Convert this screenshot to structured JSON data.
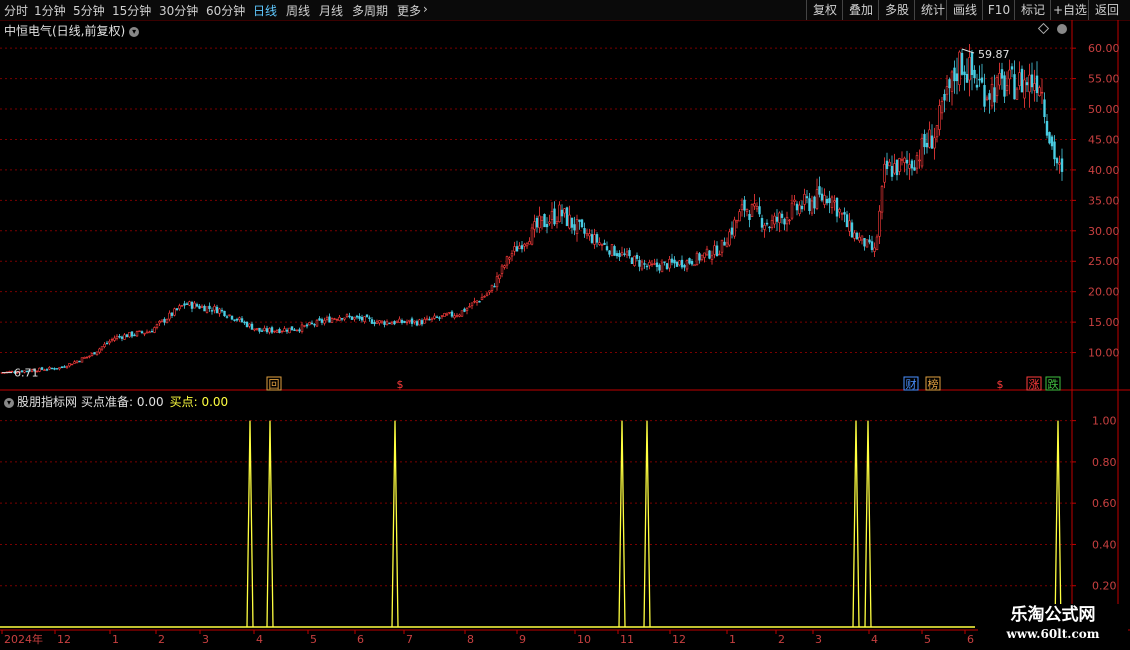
{
  "toolbar": {
    "periods": [
      {
        "label": "分时",
        "x": 4,
        "active": false
      },
      {
        "label": "1分钟",
        "x": 34,
        "active": false
      },
      {
        "label": "5分钟",
        "x": 73,
        "active": false
      },
      {
        "label": "15分钟",
        "x": 112,
        "active": false
      },
      {
        "label": "30分钟",
        "x": 159,
        "active": false
      },
      {
        "label": "60分钟",
        "x": 206,
        "active": false
      },
      {
        "label": "日线",
        "x": 253,
        "active": true
      },
      {
        "label": "周线",
        "x": 286,
        "active": false
      },
      {
        "label": "月线",
        "x": 319,
        "active": false
      },
      {
        "label": "多周期",
        "x": 352,
        "active": false
      },
      {
        "label": "更多",
        "x": 397,
        "active": false
      }
    ],
    "actions": [
      {
        "label": "复权",
        "x": 806,
        "w": 36
      },
      {
        "label": "叠加",
        "x": 842,
        "w": 36
      },
      {
        "label": "多股",
        "x": 878,
        "w": 36
      },
      {
        "label": "统计",
        "x": 914,
        "w": 36
      },
      {
        "label": "画线",
        "x": 946,
        "w": 36
      },
      {
        "label": "F10",
        "x": 982,
        "w": 32
      },
      {
        "label": "标记",
        "x": 1014,
        "w": 36
      },
      {
        "label": "+自选",
        "x": 1050,
        "w": 38
      },
      {
        "label": "返回",
        "x": 1088,
        "w": 36
      }
    ]
  },
  "stock_title": "中恒电气(日线,前复权)",
  "indicator": {
    "name": "股朋指标网",
    "label_a": "买点准备: 0.00",
    "label_b": "买点: 0.00"
  },
  "colors": {
    "up": "#ff3c3c",
    "down": "#4ad0e6",
    "grid": "#7a0000",
    "axis": "#c00000",
    "signal": "#ffff40",
    "active": "#5fc8ff"
  },
  "chart_data": [
    {
      "type": "candlestick",
      "title": "中恒电气(日线,前复权)",
      "ylim": [
        5,
        62
      ],
      "y_ticks": [
        10,
        15,
        20,
        25,
        30,
        35,
        40,
        45,
        50,
        55,
        60
      ],
      "y_tick_labels": [
        "10.00",
        "15.00",
        "20.00",
        "25.00",
        "30.00",
        "35.00",
        "40.00",
        "45.00",
        "50.00",
        "55.00",
        "60.00"
      ],
      "annotations": {
        "high": "59.87",
        "low": "6.71"
      },
      "event_marks": [
        "回",
        "$",
        "财",
        "榜",
        "$",
        "涨",
        "跌"
      ],
      "x_labels": [
        "2024年",
        "12",
        "1",
        "2",
        "3",
        "4",
        "5",
        "6",
        "7",
        "8",
        "9",
        "10",
        "11",
        "12",
        "1",
        "2",
        "3",
        "4",
        "5",
        "6",
        "6"
      ],
      "trend": [
        [
          0,
          6.7
        ],
        [
          25,
          7
        ],
        [
          60,
          7.5
        ],
        [
          90,
          9.5
        ],
        [
          115,
          12.5
        ],
        [
          150,
          13.5
        ],
        [
          185,
          18
        ],
        [
          220,
          17
        ],
        [
          260,
          13.5
        ],
        [
          300,
          14
        ],
        [
          340,
          16
        ],
        [
          380,
          15
        ],
        [
          420,
          15
        ],
        [
          460,
          16.5
        ],
        [
          490,
          20
        ],
        [
          510,
          26
        ],
        [
          540,
          31
        ],
        [
          560,
          33
        ],
        [
          580,
          30
        ],
        [
          610,
          27
        ],
        [
          650,
          24
        ],
        [
          690,
          25
        ],
        [
          720,
          27
        ],
        [
          745,
          34
        ],
        [
          770,
          31
        ],
        [
          800,
          34
        ],
        [
          830,
          36
        ],
        [
          850,
          30
        ],
        [
          875,
          26.5
        ],
        [
          885,
          40
        ],
        [
          910,
          41
        ],
        [
          935,
          46
        ],
        [
          960,
          58
        ],
        [
          985,
          53
        ],
        [
          1010,
          54
        ],
        [
          1040,
          55
        ],
        [
          1050,
          45
        ],
        [
          1063,
          38
        ]
      ]
    },
    {
      "type": "line",
      "name": "买点",
      "ylim": [
        0,
        1.1
      ],
      "y_ticks": [
        0.2,
        0.4,
        0.6,
        0.8,
        1.0
      ],
      "y_tick_labels": [
        "0.20",
        "0.40",
        "0.60",
        "0.80",
        "1.00"
      ],
      "spikes_x": [
        250,
        270,
        395,
        622,
        647,
        856,
        868,
        1058
      ],
      "spike_values": [
        1,
        1,
        1,
        1,
        1,
        1,
        1,
        1
      ],
      "baseline": 0
    }
  ],
  "watermark": {
    "line1": "乐淘公式网",
    "line2": "www.60lt.com"
  }
}
